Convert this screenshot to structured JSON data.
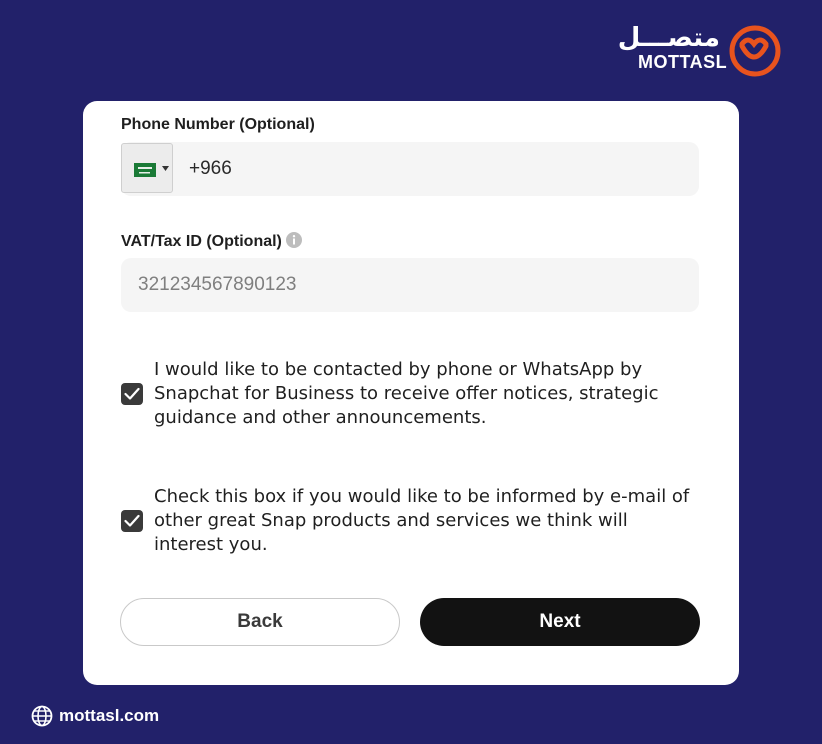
{
  "brand": {
    "arabic_name": "متصـــل",
    "latin_name": "MOTTASL",
    "accent_color": "#e8531e",
    "logo_icon": "smile-heart-icon"
  },
  "form": {
    "phone_label": "Phone Number (Optional)",
    "country_flag_icon": "saudi-flag-icon",
    "phone_value": "+966",
    "vat_label": "VAT/Tax ID (Optional)",
    "vat_info_icon": "info-icon",
    "vat_placeholder": "321234567890123",
    "consent_phone": {
      "checked": true,
      "text": "I would like to be contacted by phone or WhatsApp by Snapchat for Business to receive offer notices, strategic guidance and other announcements."
    },
    "consent_email": {
      "checked": true,
      "text": "Check this box if you would like to be informed by e-mail of other great Snap products and services we think will interest you."
    },
    "back_label": "Back",
    "next_label": "Next"
  },
  "footer": {
    "icon": "globe-icon",
    "website": "mottasl.com"
  },
  "colors": {
    "background": "#22216a",
    "card": "#ffffff",
    "primary_button": "#121212"
  }
}
